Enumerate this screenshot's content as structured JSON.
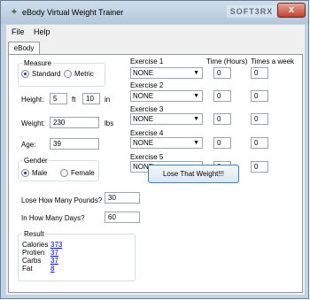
{
  "window": {
    "title": "eBody Virtual Weight Trainer",
    "watermark": "SOFT3RX",
    "close_label": "x"
  },
  "menu": {
    "file": "File",
    "help": "Help"
  },
  "tab": {
    "label": "eBody"
  },
  "measure": {
    "title": "Measure",
    "standard_label": "Standard",
    "metric_label": "Metric",
    "selected": "Standard"
  },
  "height": {
    "label": "Height:",
    "feet": "5",
    "ft_unit": "ft",
    "inches": "10",
    "in_unit": "in"
  },
  "weight": {
    "label": "Weight:",
    "value": "230",
    "unit": "lbs"
  },
  "age": {
    "label": "Age:",
    "value": "39"
  },
  "gender": {
    "title": "Gender",
    "male_label": "Male",
    "female_label": "Female",
    "selected": "Male"
  },
  "headers": {
    "time": "Time (Hours)",
    "times_week": "Times a week"
  },
  "exercises": [
    {
      "label": "Exercise 1",
      "selection": "NONE",
      "time": "0",
      "times": "0"
    },
    {
      "label": "Exercise 2",
      "selection": "NONE",
      "time": "0",
      "times": "0"
    },
    {
      "label": "Exercise 3",
      "selection": "NONE",
      "time": "0",
      "times": "0"
    },
    {
      "label": "Exercise 4",
      "selection": "NONE",
      "time": "0",
      "times": "0"
    },
    {
      "label": "Exercise 5",
      "selection": "NONE",
      "time": "0",
      "times": "0"
    }
  ],
  "goal": {
    "pounds_label": "Lose How Many Pounds?",
    "pounds_value": "30",
    "days_label": "In How Many Days?",
    "days_value": "60",
    "button_label": "Lose That Weight!!!"
  },
  "result": {
    "title": "Result",
    "calories_label": "Calories",
    "calories_value": "373",
    "protein_label": "Protien",
    "protein_value": "37",
    "carbs_label": "Carbs",
    "carbs_value": "37",
    "fat_label": "Fat",
    "fat_value": "8"
  },
  "colors": {
    "chrome": "#c2d3e4",
    "close": "#c3412b",
    "link": "#0000ee",
    "radio_dot": "#1b3f8f"
  },
  "icons": {
    "app": "app-icon",
    "dropdown": "chevron-down-icon"
  }
}
